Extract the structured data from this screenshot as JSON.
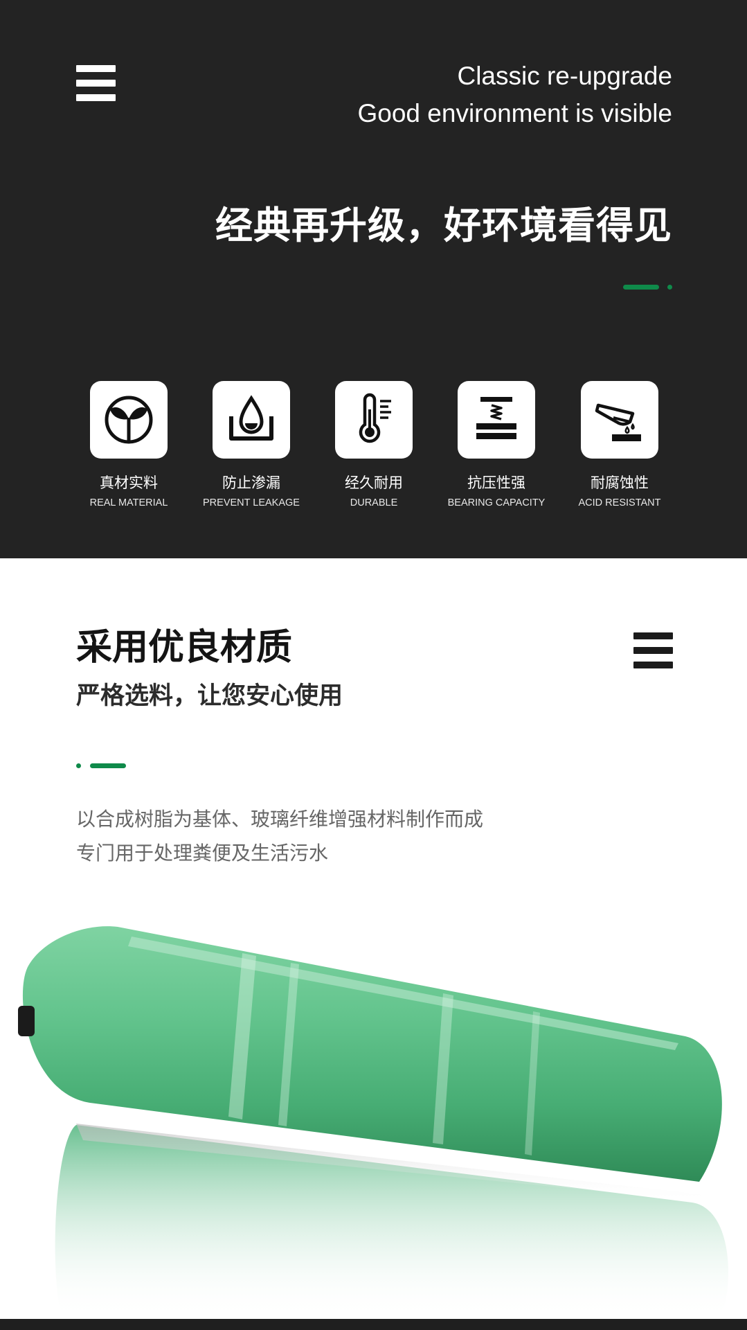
{
  "hero": {
    "tagline_line1": "Classic re-upgrade",
    "tagline_line2": "Good environment is visible",
    "title": "经典再升级，好环境看得见",
    "menu_icon": "hamburger-menu-icon"
  },
  "features": [
    {
      "icon": "sprout-icon",
      "label_zh": "真材实料",
      "label_en": "REAL MATERIAL"
    },
    {
      "icon": "water-drop-container-icon",
      "label_zh": "防止渗漏",
      "label_en": "PREVENT LEAKAGE"
    },
    {
      "icon": "thermometer-icon",
      "label_zh": "经久耐用",
      "label_en": "DURABLE"
    },
    {
      "icon": "press-spring-icon",
      "label_zh": "抗压性强",
      "label_en": "BEARING CAPACITY"
    },
    {
      "icon": "test-tube-acid-icon",
      "label_zh": "耐腐蚀性",
      "label_en": "ACID RESISTANT"
    }
  ],
  "section2": {
    "title": "采用优良材质",
    "subtitle": "严格选料，让您安心使用",
    "desc_line1": "以合成树脂为基体、玻璃纤维增强材料制作而成",
    "desc_line2": "专门用于处理粪便及生活污水",
    "menu_icon": "hamburger-menu-icon",
    "image": "fiberglass-septic-tank-image"
  },
  "colors": {
    "hero_background": "#232323",
    "accent_green": "#0f8a4a",
    "tank_green": "#5cc08a",
    "text_dark": "#141414",
    "text_gray": "#666666"
  }
}
